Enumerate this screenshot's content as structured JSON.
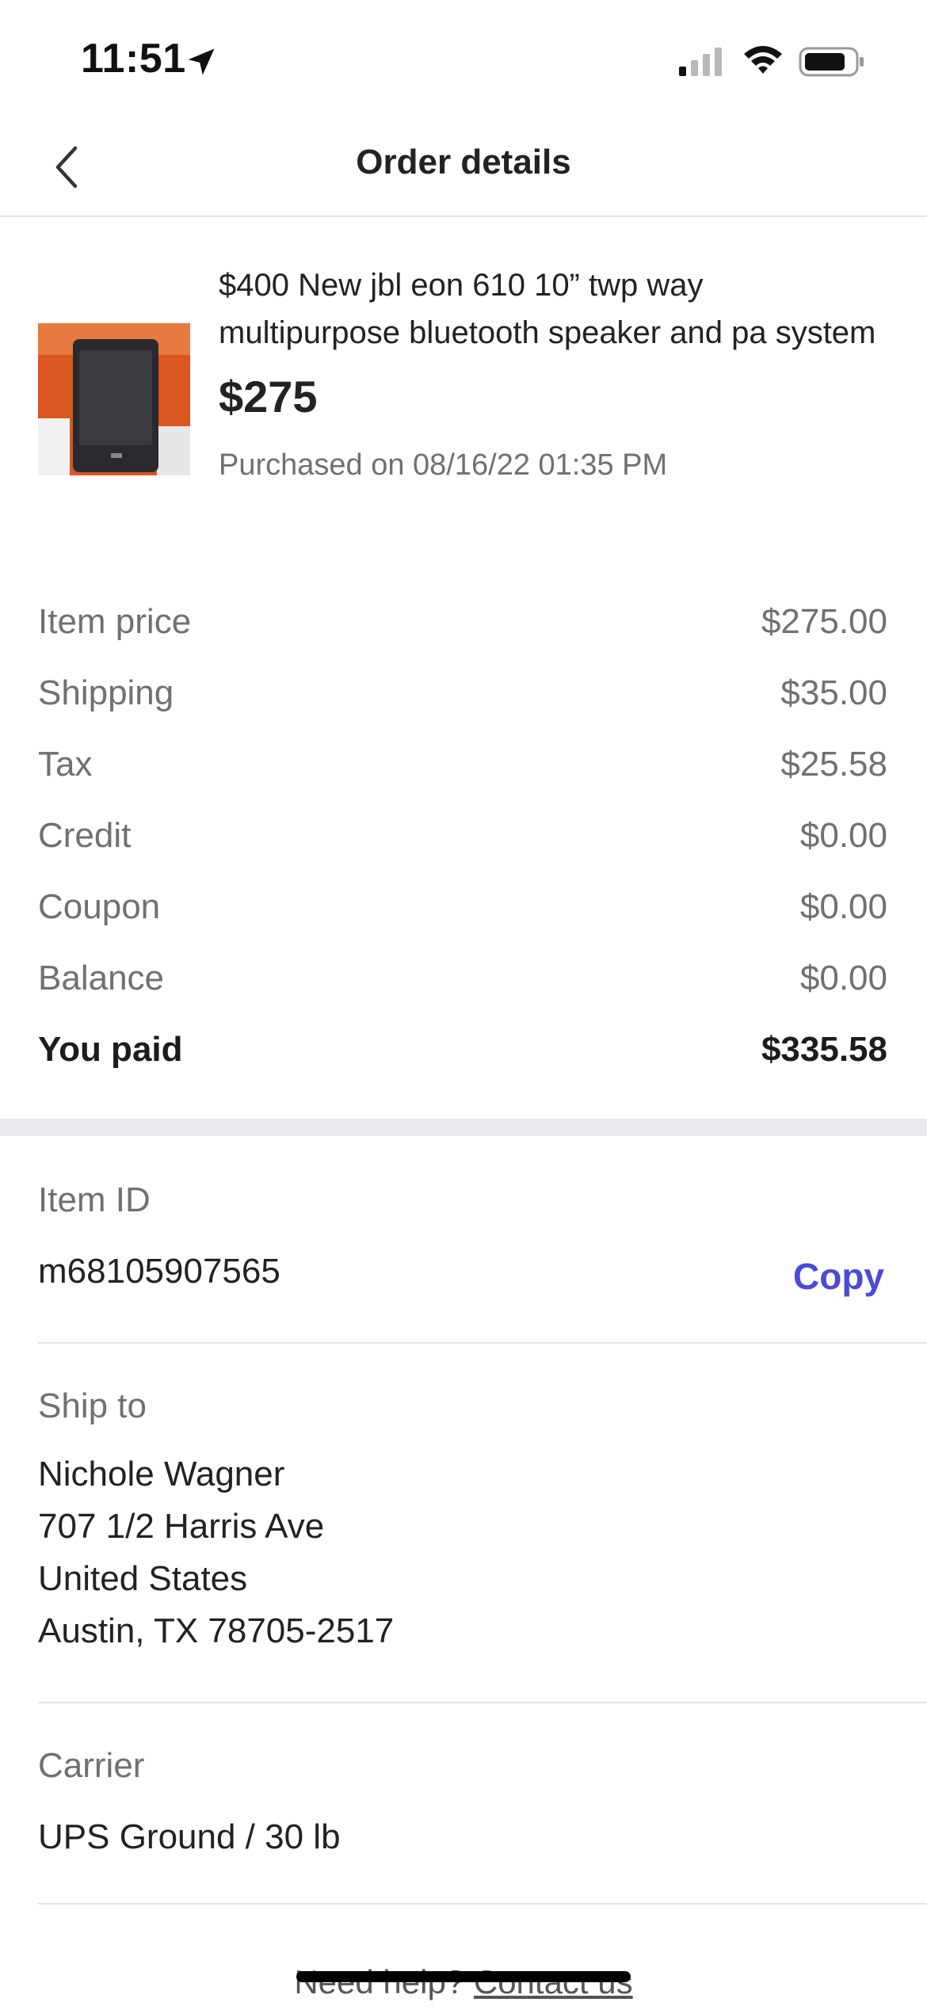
{
  "status_bar": {
    "time": "11:51"
  },
  "header": {
    "title": "Order details"
  },
  "item": {
    "title": "$400 New jbl eon 610 10” twp way multipurpose bluetooth speaker and pa system",
    "price": "$275",
    "purchased": "Purchased on 08/16/22 01:35 PM",
    "thumbnail_colors": {
      "box": "#d9561e",
      "speaker": "#2a2a2e"
    }
  },
  "breakdown": [
    {
      "label": "Item price",
      "value": "$275.00"
    },
    {
      "label": "Shipping",
      "value": "$35.00"
    },
    {
      "label": "Tax",
      "value": "$25.58"
    },
    {
      "label": "Credit",
      "value": "$0.00"
    },
    {
      "label": "Coupon",
      "value": "$0.00"
    },
    {
      "label": "Balance",
      "value": "$0.00"
    }
  ],
  "total": {
    "label": "You paid",
    "value": "$335.58"
  },
  "item_id": {
    "label": "Item ID",
    "value": "m68105907565",
    "copy_label": "Copy"
  },
  "ship_to": {
    "label": "Ship to",
    "lines": [
      "Nichole Wagner",
      "707 1/2 Harris Ave",
      "United States",
      "Austin, TX 78705-2517"
    ]
  },
  "carrier": {
    "label": "Carrier",
    "value": "UPS Ground / 30 lb"
  },
  "help": {
    "text": "Need help?",
    "link": "Contact us"
  },
  "colors": {
    "accent": "#4a4ad6",
    "muted_text": "#707070",
    "divider": "#eaeaee"
  }
}
